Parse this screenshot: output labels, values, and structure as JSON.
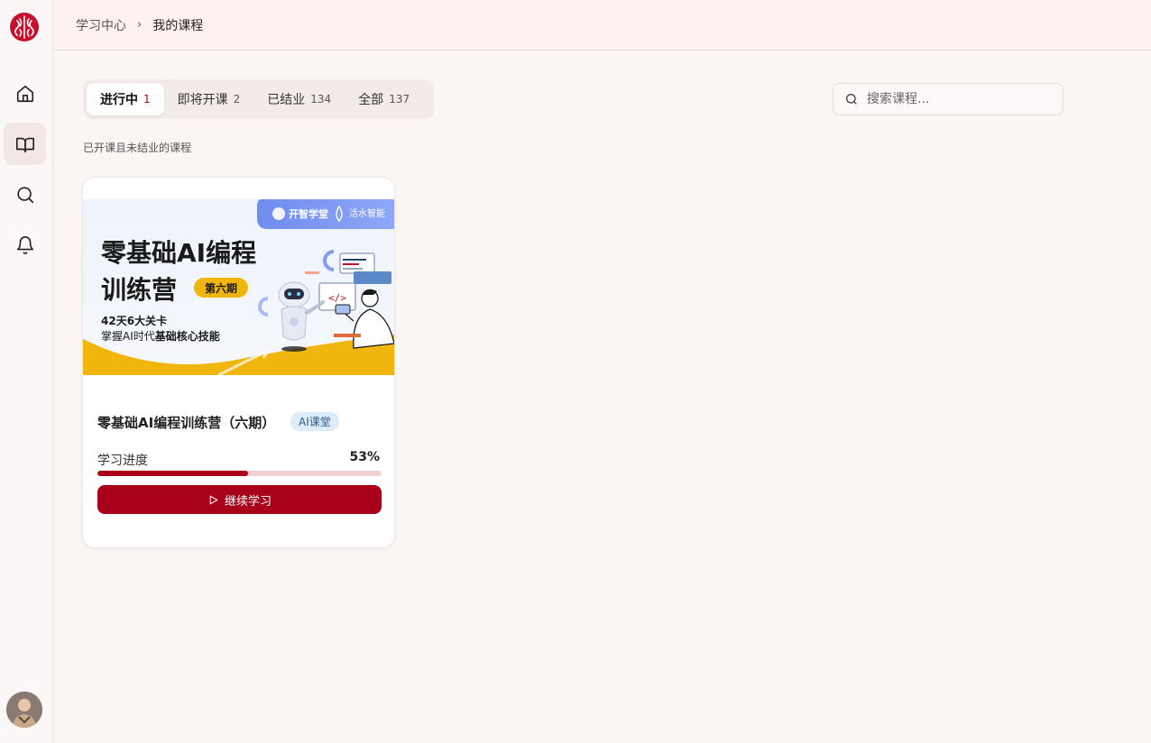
{
  "breadcrumb": {
    "root": "学习中心",
    "separator": "›",
    "current": "我的课程"
  },
  "sidebar": {
    "items": [
      {
        "icon": "home-icon",
        "active": false
      },
      {
        "icon": "book-open-icon",
        "active": true
      },
      {
        "icon": "search-icon",
        "active": false
      },
      {
        "icon": "bell-icon",
        "active": false
      }
    ]
  },
  "tabs": [
    {
      "label": "进行中",
      "count": "1",
      "active": true
    },
    {
      "label": "即将开课",
      "count": "2",
      "active": false
    },
    {
      "label": "已结业",
      "count": "134",
      "active": false
    },
    {
      "label": "全部",
      "count": "137",
      "active": false
    }
  ],
  "search": {
    "placeholder": "搜索课程..."
  },
  "section_description": "已开课且未结业的课程",
  "course": {
    "banner": {
      "brand1": "开智学堂",
      "brand2": "活水智能",
      "title_line1": "零基础AI编程",
      "title_line2": "训练营",
      "period": "第六期",
      "subtitle1": "42天6大关卡",
      "subtitle2_prefix": "掌握AI时代",
      "subtitle2_bold": "基础核心技能"
    },
    "title": "零基础AI编程训练营（六期）",
    "badge": "AI课堂",
    "progress_label": "学习进度",
    "progress_text": "53%",
    "progress_percent": 53,
    "button_label": "继续学习"
  },
  "colors": {
    "accent": "#a9001a",
    "progress_track": "#f0cfd3",
    "badge_bg": "#dcecf9"
  }
}
